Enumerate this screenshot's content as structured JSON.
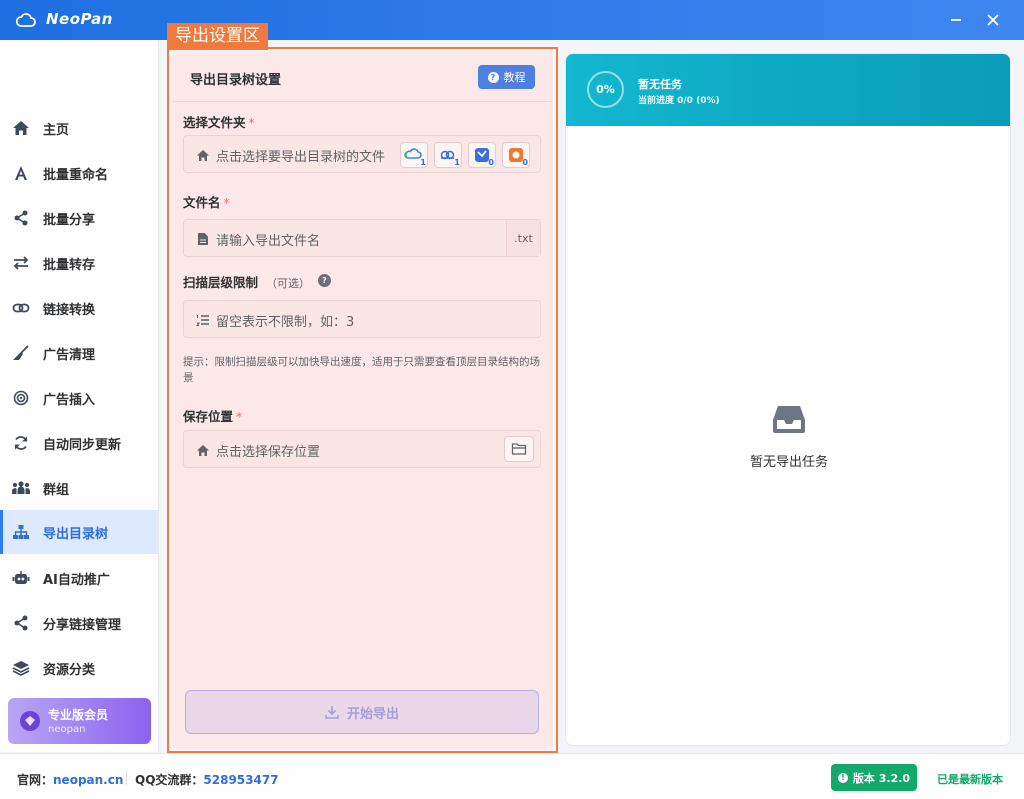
{
  "window": {
    "app_name": "NeoPan",
    "minimize_icon": "minimize-icon",
    "close_icon": "close-icon"
  },
  "annotation": {
    "label": "导出设置区",
    "color": "#f07a3e"
  },
  "sidebar": {
    "items": [
      {
        "label": "主页",
        "icon": "home-icon"
      },
      {
        "label": "批量重命名",
        "icon": "font-icon"
      },
      {
        "label": "批量分享",
        "icon": "share-icon"
      },
      {
        "label": "批量转存",
        "icon": "transfer-icon"
      },
      {
        "label": "链接转换",
        "icon": "link-icon"
      },
      {
        "label": "广告清理",
        "icon": "broom-icon"
      },
      {
        "label": "广告插入",
        "icon": "target-icon"
      },
      {
        "label": "自动同步更新",
        "icon": "sync-icon"
      },
      {
        "label": "群组",
        "icon": "group-icon"
      },
      {
        "label": "导出目录树",
        "icon": "sitemap-icon",
        "active": true
      },
      {
        "label": "AI自动推广",
        "icon": "robot-icon"
      },
      {
        "label": "分享链接管理",
        "icon": "share-icon"
      },
      {
        "label": "资源分类",
        "icon": "layers-icon"
      }
    ],
    "pro": {
      "title": "专业版会员",
      "sub": "neopan"
    }
  },
  "settings": {
    "title": "导出目录树设置",
    "tutorial_label": "教程",
    "folder": {
      "label": "选择文件夹",
      "required": "*",
      "placeholder": "点击选择要导出目录树的文件",
      "clouds": [
        {
          "icon": "cloud-drive-a-icon",
          "badge": "1"
        },
        {
          "icon": "cloud-drive-b-icon",
          "badge": "1"
        },
        {
          "icon": "cloud-drive-c-icon",
          "badge": "0"
        },
        {
          "icon": "cloud-drive-d-icon",
          "badge": "0"
        }
      ]
    },
    "filename": {
      "label": "文件名",
      "required": "*",
      "placeholder": "请输入导出文件名",
      "suffix": ".txt"
    },
    "depth": {
      "label": "扫描层级限制",
      "optional": "（可选）",
      "placeholder": "留空表示不限制，如：3"
    },
    "hint": "提示：限制扫描层级可以加快导出速度，适用于只需要查看顶层目录结构的场景",
    "save": {
      "label": "保存位置",
      "required": "*",
      "placeholder": "点击选择保存位置"
    },
    "export_label": "开始导出"
  },
  "tasks": {
    "percent": "0%",
    "title": "暂无任务",
    "progress": "当前进度 0/0 (0%)",
    "empty": "暂无导出任务"
  },
  "footer": {
    "site_label": "官网：",
    "site": "neopan.cn",
    "qq_label": "QQ交流群：",
    "qq": "528953477",
    "version": "版本 3.2.0",
    "latest": "已是最新版本"
  },
  "colors": {
    "primary": "#2e7cf6",
    "teal": "#13b7cf",
    "green": "#13a96a",
    "required": "#f56c6c"
  }
}
